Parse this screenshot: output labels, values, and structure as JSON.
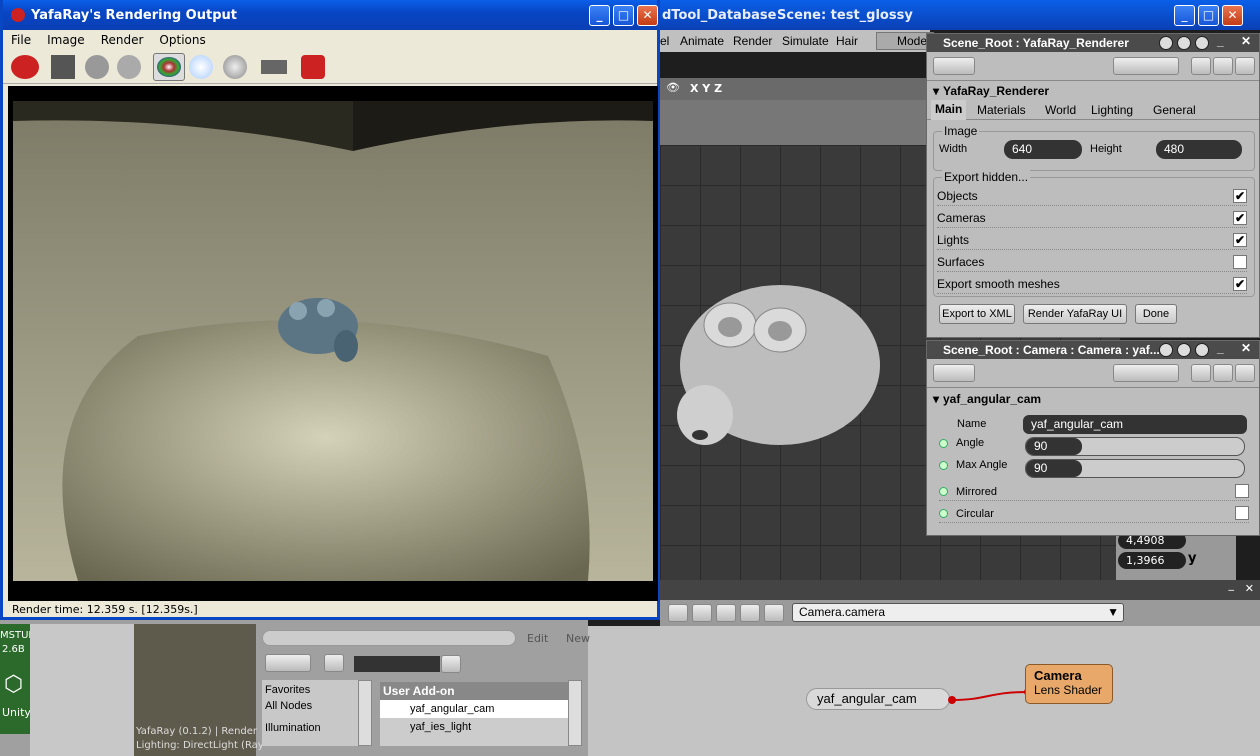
{
  "main_app": {
    "title_fragment": "dTool_Database",
    "scene": "Scene: test_glossy",
    "menu": [
      "el",
      "Animate",
      "Render",
      "Simulate",
      "Hair",
      "Mode"
    ],
    "viewport_axes": "X Y Z",
    "values": [
      "4,4908",
      "1,3966"
    ],
    "value_axes": [
      "y"
    ],
    "dropdown_value": "Camera.camera"
  },
  "render_window": {
    "title": "YafaRay's Rendering Output",
    "menu": [
      "File",
      "Image",
      "Render",
      "Options"
    ],
    "status": "Render time: 12.359 s. [12.359s.]"
  },
  "renderer_panel": {
    "header": "Scene_Root : YafaRay_Renderer",
    "section": "YafaRay_Renderer",
    "tabs": [
      "Main",
      "Materials",
      "World",
      "Lighting",
      "General"
    ],
    "image_group": "Image",
    "width_label": "Width",
    "width_value": "640",
    "height_label": "Height",
    "height_value": "480",
    "export_group": "Export hidden...",
    "options": [
      {
        "label": "Objects",
        "checked": true
      },
      {
        "label": "Cameras",
        "checked": true
      },
      {
        "label": "Lights",
        "checked": true
      },
      {
        "label": "Surfaces",
        "checked": false
      },
      {
        "label": "Export smooth meshes",
        "checked": true
      }
    ],
    "buttons": [
      "Export to XML",
      "Render YafaRay UI",
      "Done"
    ]
  },
  "camera_panel": {
    "header": "Scene_Root : Camera : Camera : yaf...",
    "section": "yaf_angular_cam",
    "name_label": "Name",
    "name_value": "yaf_angular_cam",
    "angle_label": "Angle",
    "angle_value": "90",
    "max_angle_label": "Max Angle",
    "max_angle_value": "90",
    "mirrored_label": "Mirrored",
    "circular_label": "Circular"
  },
  "preset_browser": {
    "edit": "Edit",
    "new": "New",
    "categories": [
      "Favorites",
      "All Nodes",
      "Illumination"
    ],
    "list_header": "User Add-on",
    "items": [
      "yaf_angular_cam",
      "yaf_ies_light"
    ],
    "thumb_caption1": "YafaRay (0.1.2) | Render",
    "thumb_caption2": "Lighting: DirectLight (Ray"
  },
  "render_tree": {
    "node1": "yaf_angular_cam",
    "node2_title": "Camera",
    "node2_port": "Lens Shader"
  },
  "desktop": {
    "label1": "MSTUI",
    "label2": "2.6B",
    "unity": "Unity"
  },
  "colors": {
    "xp_title": "#0846c4",
    "node_orange": "#e8a86a",
    "panel_header": "#4b4b4b"
  }
}
